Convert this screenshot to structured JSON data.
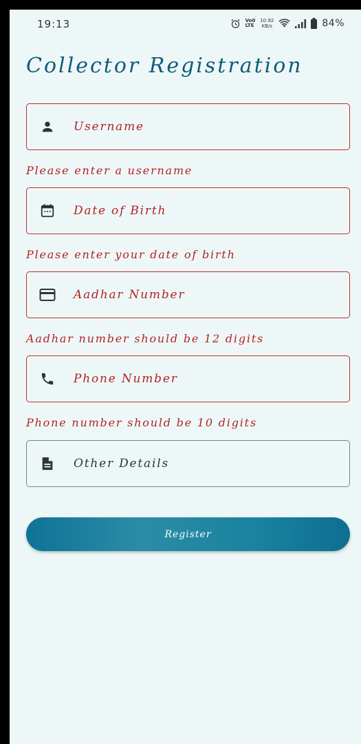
{
  "status_bar": {
    "time": "19:13",
    "volte_top": "Vo0",
    "volte_bottom": "LTE",
    "net_speed_value": "10.92",
    "net_speed_unit": "KB/s",
    "battery_percent": "84%"
  },
  "title": "Collector Registration",
  "fields": {
    "username": {
      "placeholder": "Username",
      "icon": "person-icon",
      "error": "Please enter a username"
    },
    "dob": {
      "placeholder": "Date of Birth",
      "icon": "calendar-icon",
      "error": "Please enter your date of birth"
    },
    "aadhar": {
      "placeholder": "Aadhar Number",
      "icon": "credit-card-icon",
      "error": "Aadhar number should be 12 digits"
    },
    "phone": {
      "placeholder": "Phone Number",
      "icon": "phone-icon",
      "error": "Phone number should be 10 digits"
    },
    "other": {
      "placeholder": "Other Details",
      "icon": "document-icon"
    }
  },
  "register_button": {
    "label": "Register"
  },
  "colors": {
    "background": "#eef7f8",
    "title": "#0e5b78",
    "error": "#b32222",
    "error_border": "#c22a2a",
    "neutral_border": "#7a8086",
    "button": "#0e7396"
  }
}
